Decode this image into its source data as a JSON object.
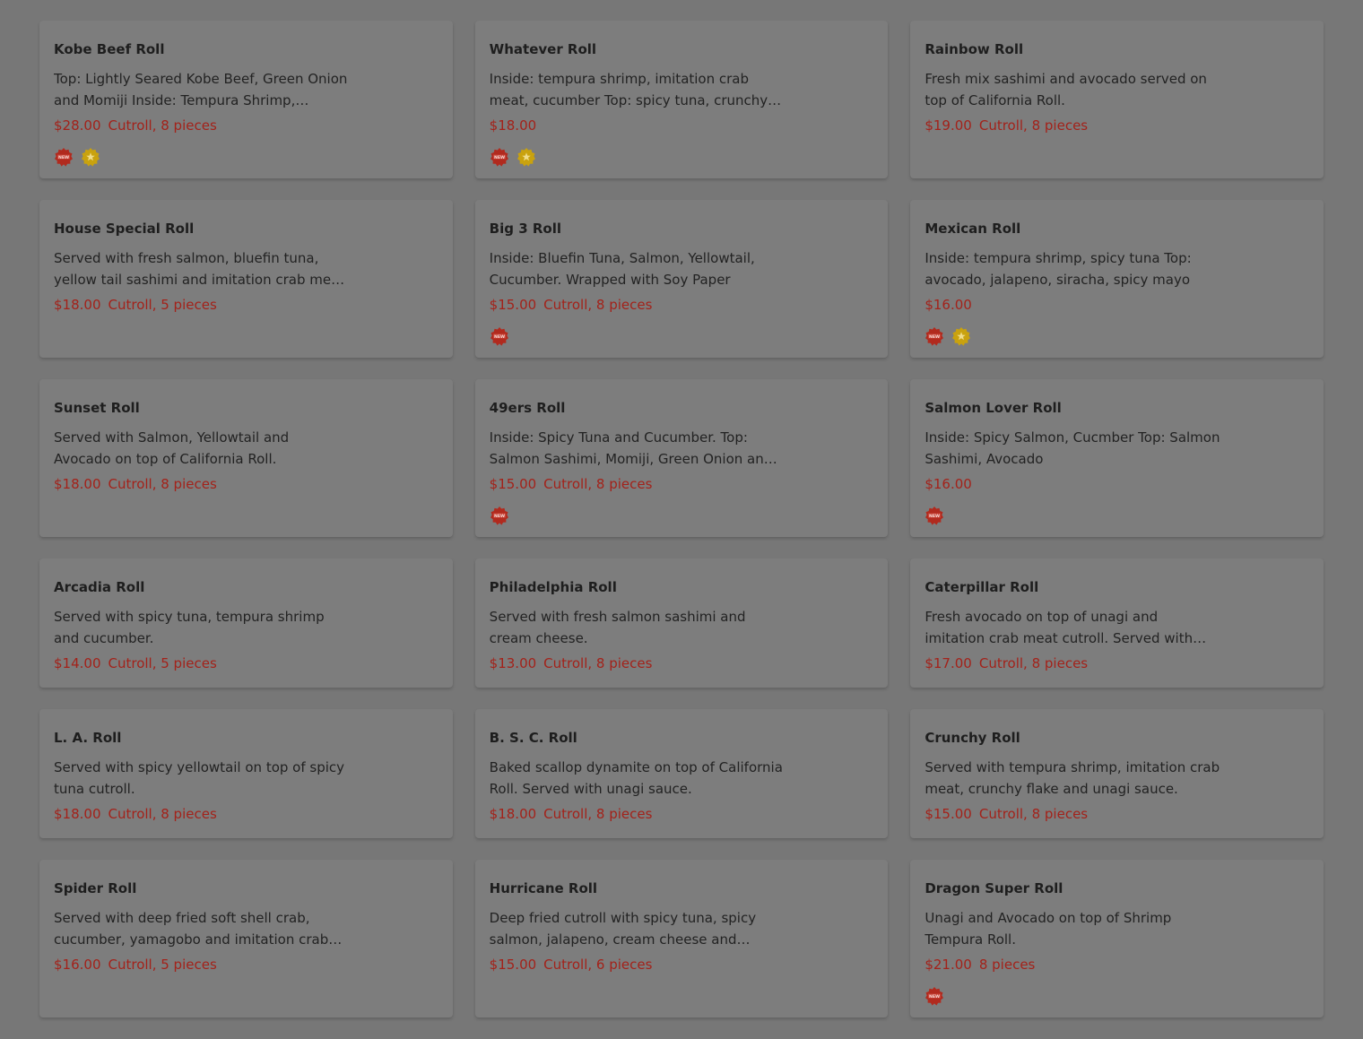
{
  "colors": {
    "background": "#777777",
    "card": "#7d7d7d",
    "price": "#a3221a",
    "new_badge": "#b12a1e",
    "star_badge": "#c9a20e"
  },
  "items": [
    {
      "name": "Kobe Beef Roll",
      "desc": "Top: Lightly Seared Kobe Beef, Green Onion and Momiji Inside: Tempura Shrimp, Imitation Crab Meat",
      "price": "$28.00",
      "unit": "Cutroll, 8 pieces",
      "badges": [
        "new-icon",
        "star-icon"
      ]
    },
    {
      "name": "Whatever Roll",
      "desc": "Inside: tempura shrimp, imitation crab meat, cucumber Top: spicy tuna, crunchy flake and unagi sauce",
      "price": "$18.00",
      "unit": "",
      "badges": [
        "new-icon",
        "star-icon"
      ]
    },
    {
      "name": "Rainbow Roll",
      "desc": "Fresh mix sashimi and avocado served on top of California Roll.",
      "price": "$19.00",
      "unit": "Cutroll, 8 pieces",
      "badges": []
    },
    {
      "name": "House Special Roll",
      "desc": "Served with fresh salmon, bluefin tuna, yellow tail sashimi and imitation crab meat. Wrapped with soy paper",
      "price": "$18.00",
      "unit": "Cutroll, 5 pieces",
      "badges": []
    },
    {
      "name": "Big 3 Roll",
      "desc": "Inside: Bluefin Tuna, Salmon, Yellowtail, Cucumber. Wrapped with Soy Paper",
      "price": "$15.00",
      "unit": "Cutroll, 8 pieces",
      "badges": [
        "new-icon"
      ]
    },
    {
      "name": "Mexican Roll",
      "desc": "Inside: tempura shrimp, spicy tuna Top: avocado, jalapeno, siracha, spicy mayo",
      "price": "$16.00",
      "unit": "",
      "badges": [
        "new-icon",
        "star-icon"
      ]
    },
    {
      "name": "Sunset Roll",
      "desc": "Served with Salmon, Yellowtail and Avocado on top of California Roll.",
      "price": "$18.00",
      "unit": "Cutroll, 8 pieces",
      "badges": []
    },
    {
      "name": "49ers Roll",
      "desc": "Inside: Spicy Tuna and Cucumber.  Top: Salmon Sashimi, Momiji, Green Onion and Ponzu Sauce",
      "price": "$15.00",
      "unit": "Cutroll, 8 pieces",
      "badges": [
        "new-icon"
      ]
    },
    {
      "name": "Salmon Lover Roll",
      "desc": "Inside: Spicy Salmon, Cucmber Top: Salmon Sashimi, Avocado",
      "price": "$16.00",
      "unit": "",
      "badges": [
        "new-icon"
      ]
    },
    {
      "name": "Arcadia Roll",
      "desc": "Served with spicy tuna, tempura shrimp and cucumber.",
      "price": "$14.00",
      "unit": "Cutroll, 5 pieces",
      "badges": []
    },
    {
      "name": "Philadelphia Roll",
      "desc": "Served with fresh salmon sashimi and cream cheese.",
      "price": "$13.00",
      "unit": "Cutroll, 8 pieces",
      "badges": []
    },
    {
      "name": "Caterpillar Roll",
      "desc": "Fresh avocado on top of unagi and imitation crab meat cutroll. Served with unagi sauce.",
      "price": "$17.00",
      "unit": "Cutroll, 8 pieces",
      "badges": []
    },
    {
      "name": "L. A. Roll",
      "desc": "Served with spicy yellowtail on top of spicy tuna cutroll.",
      "price": "$18.00",
      "unit": "Cutroll, 8 pieces",
      "badges": []
    },
    {
      "name": "B. S. C. Roll",
      "desc": "Baked scallop dynamite on top of California Roll. Served with unagi sauce.",
      "price": "$18.00",
      "unit": "Cutroll, 8 pieces",
      "badges": []
    },
    {
      "name": "Crunchy Roll",
      "desc": "Served with tempura shrimp, imitation crab meat, crunchy flake and unagi sauce.",
      "price": "$15.00",
      "unit": "Cutroll, 8 pieces",
      "badges": []
    },
    {
      "name": "Spider Roll",
      "desc": "Served with deep fried soft shell crab, cucumber, yamagobo and imitation crab meat.",
      "price": "$16.00",
      "unit": "Cutroll, 5 pieces",
      "badges": []
    },
    {
      "name": "Hurricane Roll",
      "desc": "Deep fried cutroll with spicy tuna, spicy salmon, jalapeno, cream cheese and imitation crab meat.",
      "price": "$15.00",
      "unit": "Cutroll, 6 pieces",
      "badges": []
    },
    {
      "name": "Dragon Super Roll",
      "desc": "Unagi and Avocado on top of Shrimp Tempura Roll.",
      "price": "$21.00",
      "unit": "8 pieces",
      "badges": [
        "new-icon"
      ]
    }
  ]
}
